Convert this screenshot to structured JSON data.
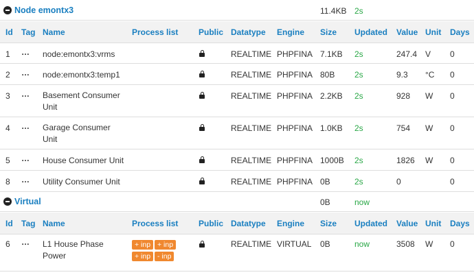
{
  "columns": {
    "id": "Id",
    "tag": "Tag",
    "name": "Name",
    "process": "Process list",
    "public": "Public",
    "datatype": "Datatype",
    "engine": "Engine",
    "size": "Size",
    "updated": "Updated",
    "value": "Value",
    "unit": "Unit",
    "days": "Days"
  },
  "nodes": [
    {
      "name": "Node emontx3",
      "size": "11.4KB",
      "updated": "2s",
      "feeds": [
        {
          "id": "1",
          "tag": "…",
          "name": "node:emontx3:vrms",
          "datatype": "REALTIME",
          "engine": "PHPFINA",
          "size": "7.1KB",
          "updated": "2s",
          "value": "247.4",
          "unit": "V",
          "days": "0"
        },
        {
          "id": "2",
          "tag": "…",
          "name": "node:emontx3:temp1",
          "datatype": "REALTIME",
          "engine": "PHPFINA",
          "size": "80B",
          "updated": "2s",
          "value": "9.3",
          "unit": "°C",
          "days": "0"
        },
        {
          "id": "3",
          "tag": "…",
          "name": "Basement Consumer Unit",
          "datatype": "REALTIME",
          "engine": "PHPFINA",
          "size": "2.2KB",
          "updated": "2s",
          "value": "928",
          "unit": "W",
          "days": "0"
        },
        {
          "id": "4",
          "tag": "…",
          "name": "Garage Consumer Unit",
          "datatype": "REALTIME",
          "engine": "PHPFINA",
          "size": "1.0KB",
          "updated": "2s",
          "value": "754",
          "unit": "W",
          "days": "0"
        },
        {
          "id": "5",
          "tag": "…",
          "name": "House Consumer Unit",
          "datatype": "REALTIME",
          "engine": "PHPFINA",
          "size": "1000B",
          "updated": "2s",
          "value": "1826",
          "unit": "W",
          "days": "0"
        },
        {
          "id": "8",
          "tag": "…",
          "name": "Utility Consumer Unit",
          "datatype": "REALTIME",
          "engine": "PHPFINA",
          "size": "0B",
          "updated": "2s",
          "value": "0",
          "unit": "",
          "days": "0"
        }
      ]
    },
    {
      "name": "Virtual",
      "size": "0B",
      "updated": "now",
      "feeds": [
        {
          "id": "6",
          "tag": "…",
          "name": "L1 House Phase Power",
          "datatype": "REALTIME",
          "engine": "VIRTUAL",
          "size": "0B",
          "updated": "now",
          "value": "3508",
          "unit": "W",
          "days": "0",
          "process": [
            "+ inp",
            "+ inp",
            "+ inp",
            "- inp"
          ]
        }
      ]
    }
  ],
  "colors": {
    "accent": "#1a7fc0",
    "updated": "#28a745",
    "process_badge": "#f0882f"
  },
  "icons": {
    "collapse": "minus-circle-icon",
    "public": "lock-icon"
  }
}
